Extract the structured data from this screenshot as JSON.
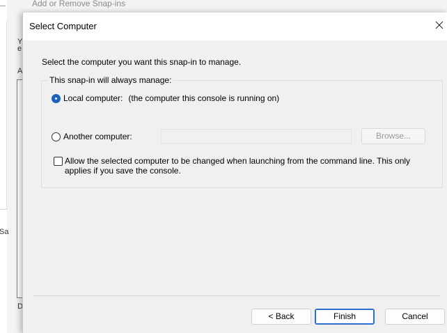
{
  "background": {
    "window_title": "Add or Remove Snap-ins",
    "fragments": [
      "Y",
      "e",
      "A",
      "Sa",
      "D"
    ]
  },
  "dialog": {
    "title": "Select Computer",
    "intro": "Select the computer you want this snap-in to manage.",
    "group_label": "This snap-in will always manage:",
    "local_option": {
      "label": "Local computer:",
      "detail": "(the computer this console is running on)",
      "selected": true
    },
    "another_option": {
      "label": "Another computer:",
      "selected": false,
      "value": "",
      "browse_label": "Browse..."
    },
    "allow_change": {
      "label": "Allow the selected computer to be changed when launching from the command line.  This only applies if you save the console.",
      "checked": false
    },
    "buttons": {
      "back": "< Back",
      "finish": "Finish",
      "cancel": "Cancel"
    }
  },
  "colors": {
    "accent": "#1f5fbf",
    "dialog_background": "#f0f0f0",
    "titlebar_background": "#ffffff"
  }
}
